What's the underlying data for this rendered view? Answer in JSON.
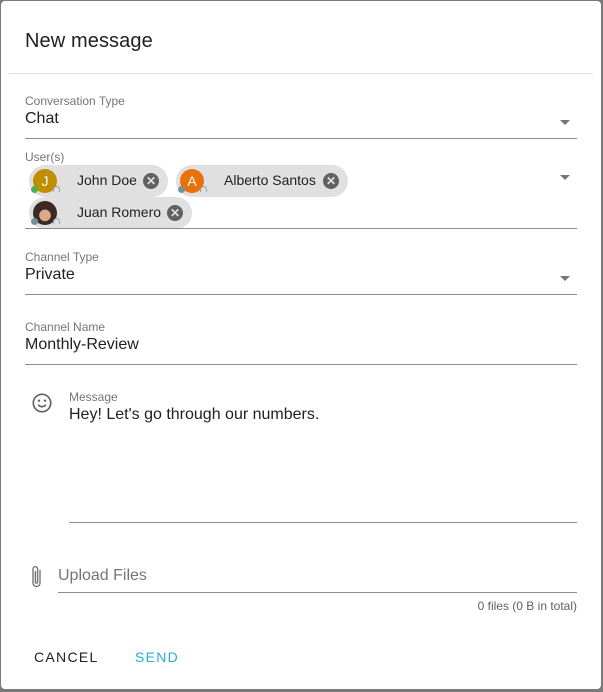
{
  "dialog": {
    "title": "New message"
  },
  "conversation_type": {
    "label": "Conversation Type",
    "value": "Chat"
  },
  "users": {
    "label": "User(s)",
    "chips": [
      {
        "name": "John Doe",
        "initial": "J",
        "avatar_color": "#bf8f00",
        "status_color": "#4caf50",
        "remove_icon": "close-circle-icon"
      },
      {
        "name": "Alberto Santos",
        "initial": "A",
        "avatar_color": "#e8710a",
        "status_color": "#78909c",
        "remove_icon": "close-circle-icon"
      },
      {
        "name": "Juan Romero",
        "initial": "",
        "avatar_type": "photo",
        "status_color": "#78909c",
        "remove_icon": "close-circle-icon"
      }
    ]
  },
  "channel_type": {
    "label": "Channel Type",
    "value": "Private"
  },
  "channel_name": {
    "label": "Channel Name",
    "value": "Monthly-Review"
  },
  "message": {
    "label": "Message",
    "value": "Hey! Let's go through our numbers.",
    "icon": "emoji-icon"
  },
  "upload": {
    "placeholder": "Upload Files",
    "summary": "0 files (0 B in total)",
    "icon": "paperclip-icon"
  },
  "actions": {
    "cancel_label": "CANCEL",
    "send_label": "SEND",
    "send_color": "#29a8e0"
  }
}
